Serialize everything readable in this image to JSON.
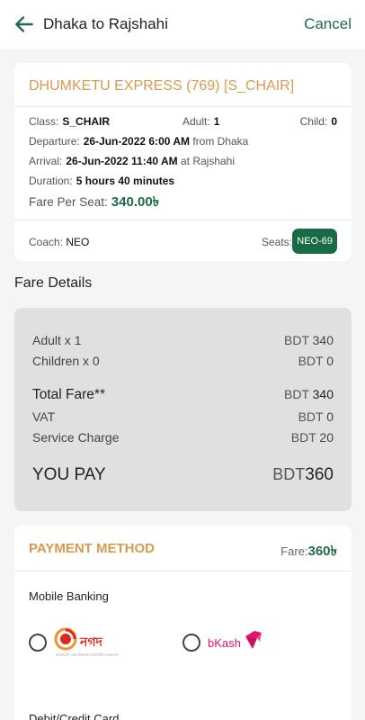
{
  "header": {
    "title": "Dhaka to Rajshahi",
    "cancel_label": "Cancel"
  },
  "train": {
    "name": "DHUMKETU EXPRESS (769) [S_CHAIR]",
    "class_label": "Class:",
    "class_value": "S_CHAIR",
    "adult_label": "Adult:",
    "adult_value": "1",
    "child_label": "Child:",
    "child_value": "0",
    "departure_label": "Departure:",
    "departure_value": "26-Jun-2022 6:00 AM",
    "departure_from": "from Dhaka",
    "arrival_label": "Arrival:",
    "arrival_value": "26-Jun-2022 11:40 AM",
    "arrival_to": "at Rajshahi",
    "duration_label": "Duration:",
    "duration_value": "5 hours 40 minutes",
    "fare_label": "Fare Per Seat:",
    "fare_value": "340.00৳",
    "coach_label": "Coach:",
    "coach_value": "NEO",
    "seats_label": "Seats:",
    "seats_value": "NEO-69"
  },
  "fare_details": {
    "title": "Fare Details",
    "adult_label": "Adult x 1",
    "adult_amount": "340",
    "children_label": "Children x 0",
    "children_amount": "0",
    "total_label": "Total Fare**",
    "total_amount": "340",
    "vat_label": "VAT",
    "vat_amount": "0",
    "service_label": "Service Charge",
    "service_amount": "20",
    "pay_label": "YOU PAY",
    "pay_amount": "360",
    "currency": "BDT"
  },
  "payment": {
    "title": "PAYMENT METHOD",
    "fare_label": "Fare:",
    "fare_value": "360৳",
    "mobile_banking_label": "Mobile Banking",
    "nagad_label": "নগদ",
    "nagad_tagline": "বাংলাদেশ ডাক বিভাগের ডিজিটাল লেনদেন",
    "bkash_label": "bKash",
    "card_label": "Debit/Credit Card"
  },
  "colors": {
    "accent_green": "#1e6b45",
    "gold": "#d79a4e",
    "nagad_red": "#e3261d",
    "bkash_pink": "#e2136e"
  }
}
